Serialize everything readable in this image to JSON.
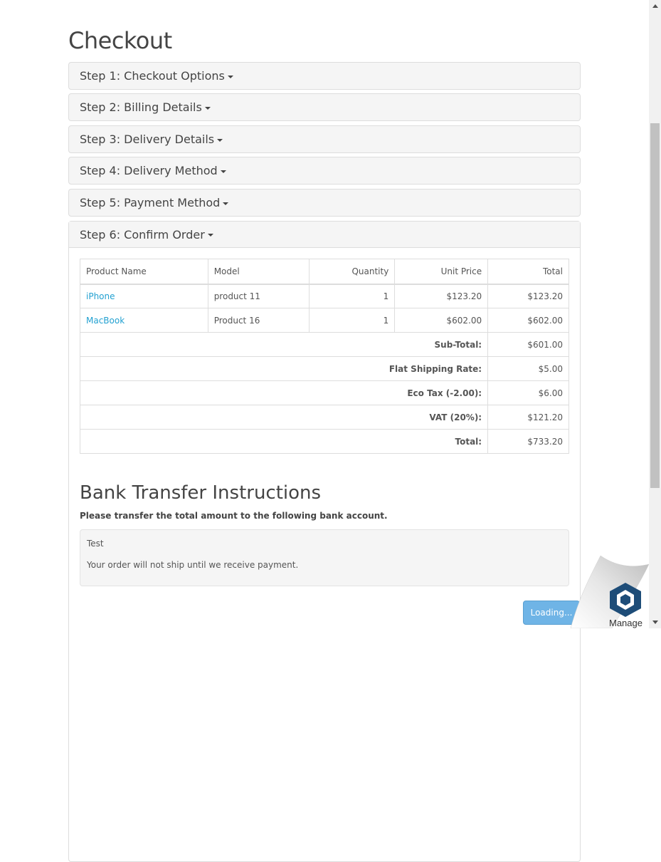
{
  "page": {
    "title": "Checkout"
  },
  "steps": [
    {
      "label": "Step 1: Checkout Options"
    },
    {
      "label": "Step 2: Billing Details"
    },
    {
      "label": "Step 3: Delivery Details"
    },
    {
      "label": "Step 4: Delivery Method"
    },
    {
      "label": "Step 5: Payment Method"
    },
    {
      "label": "Step 6: Confirm Order"
    }
  ],
  "order_table": {
    "headers": {
      "product_name": "Product Name",
      "model": "Model",
      "quantity": "Quantity",
      "unit_price": "Unit Price",
      "total": "Total"
    },
    "rows": [
      {
        "name": "iPhone",
        "model": "product 11",
        "quantity": "1",
        "unit_price": "$123.20",
        "total": "$123.20"
      },
      {
        "name": "MacBook",
        "model": "Product 16",
        "quantity": "1",
        "unit_price": "$602.00",
        "total": "$602.00"
      }
    ],
    "totals": [
      {
        "label": "Sub-Total:",
        "value": "$601.00"
      },
      {
        "label": "Flat Shipping Rate:",
        "value": "$5.00"
      },
      {
        "label": "Eco Tax (-2.00):",
        "value": "$6.00"
      },
      {
        "label": "VAT (20%):",
        "value": "$121.20"
      },
      {
        "label": "Total:",
        "value": "$733.20"
      }
    ]
  },
  "bank": {
    "title": "Bank Transfer Instructions",
    "subtitle": "Please transfer the total amount to the following bank account.",
    "details": "Test",
    "note": "Your order will not ship until we receive payment."
  },
  "confirm_button": {
    "label": "Loading..."
  },
  "manage_widget": {
    "label": "Manage",
    "icon": "manage-hexagon-icon"
  },
  "colors": {
    "link": "#23a1d1",
    "button": "#6fb4e6",
    "panel_bg": "#f5f5f5"
  }
}
